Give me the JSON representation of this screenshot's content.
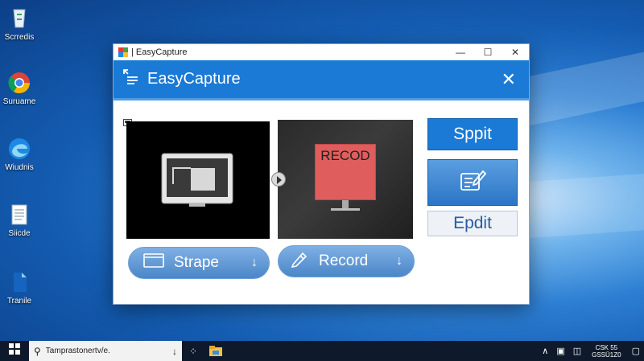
{
  "desktop": {
    "icons": [
      {
        "label": "Scrredis",
        "icon": "recycle-bin-icon"
      },
      {
        "label": "Suruame",
        "icon": "chrome-icon"
      },
      {
        "label": "Wiudnis",
        "icon": "edge-icon"
      },
      {
        "label": "Siicde",
        "icon": "document-icon"
      },
      {
        "label": "Tranile",
        "icon": "file-icon"
      }
    ]
  },
  "window": {
    "title": "| EasyCapture",
    "header_title": "EasyCapture",
    "controls": {
      "minimize": "—",
      "maximize": "☐",
      "close": "✕"
    },
    "header_close": "✕"
  },
  "preview": {
    "record_label": "RECOD"
  },
  "buttons": {
    "strape": "Strape",
    "record": "Record",
    "sppit": "Sppit",
    "epdit": "Epdit"
  },
  "taskbar": {
    "search_text": "Tamprastonertv/e.",
    "clock_line1": "CSK 55",
    "clock_line2": "GSSÜ1Z0"
  },
  "colors": {
    "accent": "#1a7ad6",
    "record_screen": "#e05d5d"
  }
}
